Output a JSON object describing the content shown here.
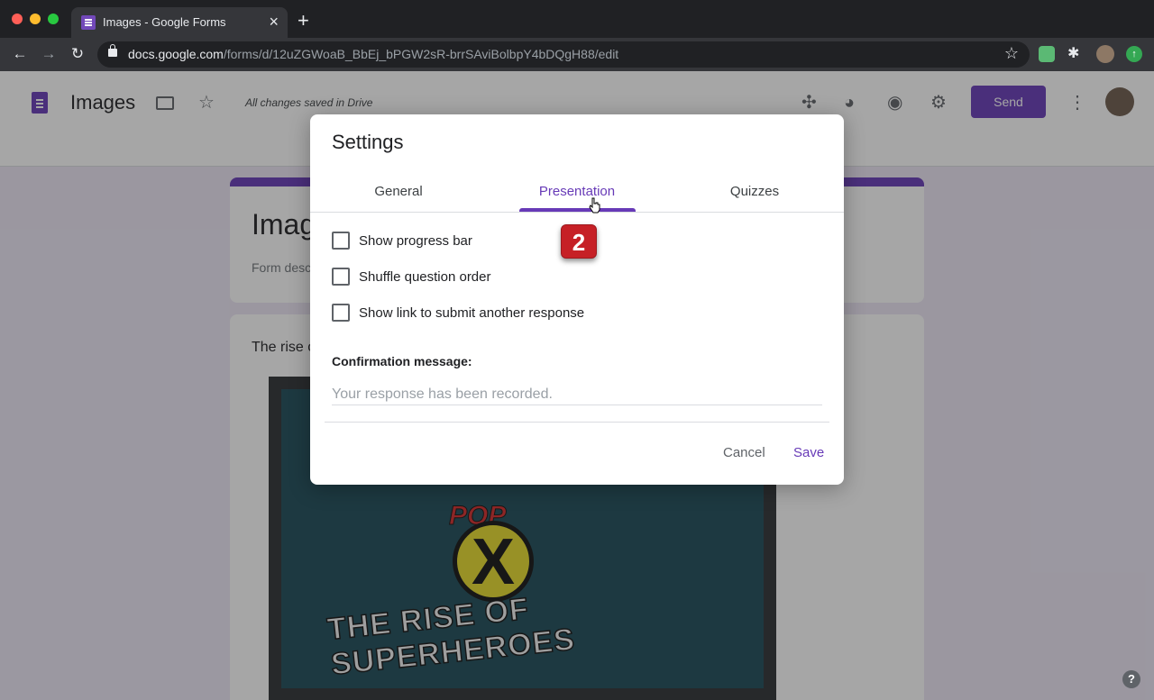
{
  "browser": {
    "tab_title": "Images - Google Forms",
    "tab_close": "×",
    "new_tab": "+",
    "url_host": "docs.google.com",
    "url_path": "/forms/d/12uZGWoaB_BbEj_bPGW2sR-brrSAviBolbpY4bDQgH88/edit"
  },
  "header": {
    "doc_title": "Images",
    "save_status": "All changes saved in Drive",
    "send_label": "Send"
  },
  "form": {
    "title": "Images",
    "description": "Form description",
    "question_text": "The rise of superheroes",
    "image_logo_word": "POP",
    "image_caption": "THE RISE OF SUPERHEROES"
  },
  "dialog": {
    "title": "Settings",
    "tabs": [
      {
        "label": "General"
      },
      {
        "label": "Presentation"
      },
      {
        "label": "Quizzes"
      }
    ],
    "active_tab": "Presentation",
    "options": [
      {
        "label": "Show progress bar",
        "checked": false
      },
      {
        "label": "Shuffle question order",
        "checked": false
      },
      {
        "label": "Show link to submit another response",
        "checked": false
      }
    ],
    "confirmation_label": "Confirmation message:",
    "confirmation_placeholder": "Your response has been recorded.",
    "cancel_label": "Cancel",
    "save_label": "Save"
  },
  "annotation": {
    "step_number": "2"
  },
  "colors": {
    "accent": "#673ab7",
    "badge": "#c62026",
    "page_background": "#ede7f6"
  }
}
